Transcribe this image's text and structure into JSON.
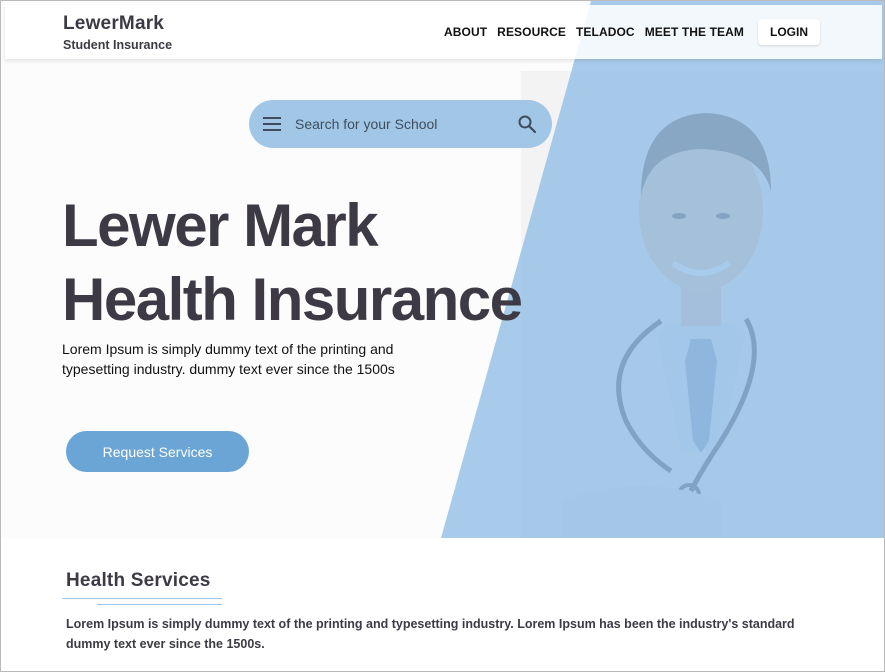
{
  "header": {
    "brand_name": "LewerMark",
    "brand_subtitle": "Student Insurance",
    "nav": [
      "ABOUT",
      "RESOURCE",
      "TELADOC",
      "MEET THE TEAM"
    ],
    "login_label": "LOGIN"
  },
  "search": {
    "placeholder": "Search for your School",
    "menu_icon": "hamburger-menu-icon",
    "search_icon": "magnifier-icon"
  },
  "hero": {
    "title_line1": "Lewer Mark",
    "title_line2": "Health Insurance",
    "description": "Lorem Ipsum is simply dummy text of the printing and typesetting industry. dummy text ever since the 1500s",
    "cta_label": "Request Services",
    "image": "doctor-with-stethoscope"
  },
  "services": {
    "title": "Health Services",
    "description": "Lorem Ipsum is simply dummy text of the printing and typesetting industry. Lorem Ipsum has been the industry's standard dummy text ever since the 1500s."
  },
  "colors": {
    "accent_blue": "#6aa5d6",
    "panel_blue": "#a2c7e6",
    "text_dark": "#3d3a45"
  }
}
